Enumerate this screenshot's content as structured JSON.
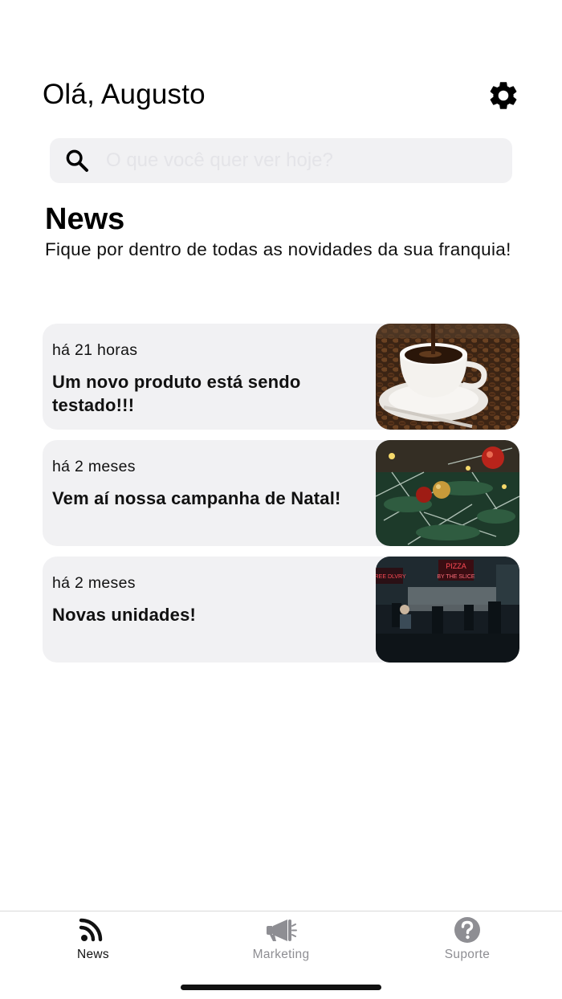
{
  "header": {
    "greeting": "Olá, Augusto",
    "settings_icon": "gear-icon"
  },
  "search": {
    "placeholder": "O que você quer ver hoje?",
    "value": "",
    "icon": "search-icon"
  },
  "section": {
    "title": "News",
    "subtitle": "Fique por dentro de todas as novidades da sua franquia!"
  },
  "news": [
    {
      "time": "há 21 horas",
      "title": "Um novo produto está sendo testado!!!",
      "image": "coffee-cup-photo"
    },
    {
      "time": "há 2 meses",
      "title": "Vem aí nossa campanha de Natal!",
      "image": "christmas-tree-photo"
    },
    {
      "time": "há 2 meses",
      "title": "Novas unidades!",
      "image": "pizza-shop-photo"
    }
  ],
  "tabs": [
    {
      "label": "News",
      "icon": "rss-icon",
      "active": true,
      "color": "#111111"
    },
    {
      "label": "Marketing",
      "icon": "megaphone-icon",
      "active": false,
      "color": "#8e8e93"
    },
    {
      "label": "Suporte",
      "icon": "question-circle-icon",
      "active": false,
      "color": "#8e8e93"
    }
  ]
}
